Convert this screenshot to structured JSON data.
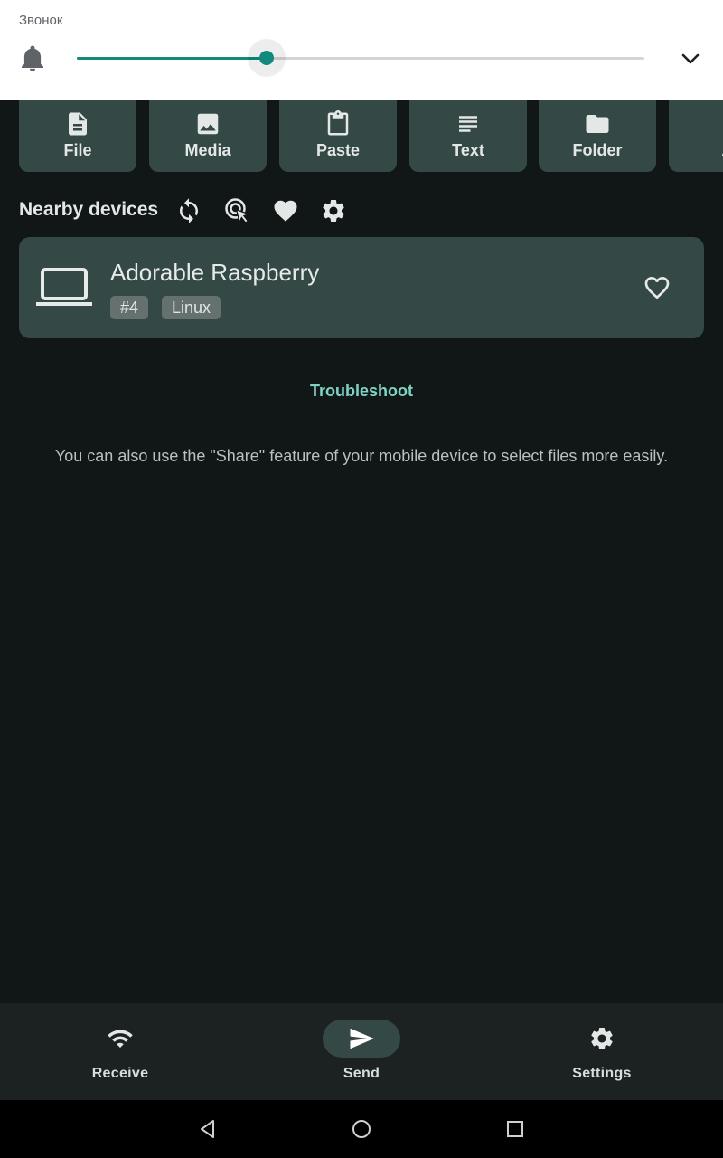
{
  "volume_panel": {
    "label": "Звонок",
    "level_percent": 33.4,
    "accent_color": "#0f8a7c",
    "icons": {
      "stream": "bell-icon",
      "expand": "chevron-down-icon"
    }
  },
  "actions": [
    {
      "label": "File",
      "icon": "file-icon"
    },
    {
      "label": "Media",
      "icon": "image-icon"
    },
    {
      "label": "Paste",
      "icon": "clipboard-icon"
    },
    {
      "label": "Text",
      "icon": "text-lines-icon"
    },
    {
      "label": "Folder",
      "icon": "folder-icon"
    },
    {
      "label": "A",
      "icon": "more-icon"
    }
  ],
  "nearby": {
    "title": "Nearby devices",
    "icons": [
      "refresh-icon",
      "manual-target-icon",
      "favorites-heart-icon",
      "settings-gear-icon"
    ]
  },
  "device": {
    "name": "Adorable Raspberry",
    "tags": [
      "#4",
      "Linux"
    ],
    "icon": "laptop-icon",
    "favorite_icon": "heart-outline-icon"
  },
  "troubleshoot_label": "Troubleshoot",
  "hint_text": "You can also use the \"Share\" feature of your mobile device to select files more easily.",
  "bottom_nav": {
    "items": [
      {
        "label": "Receive",
        "icon": "wifi-icon",
        "active": false
      },
      {
        "label": "Send",
        "icon": "send-icon",
        "active": true
      },
      {
        "label": "Settings",
        "icon": "gear-icon",
        "active": false
      }
    ]
  },
  "colors": {
    "background": "#111716",
    "surface": "#344846",
    "accent_text": "#7fd3c5"
  }
}
